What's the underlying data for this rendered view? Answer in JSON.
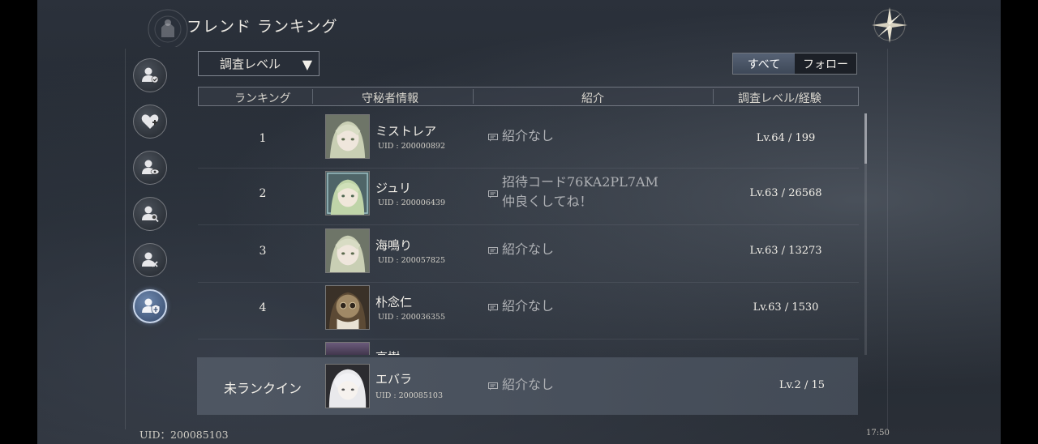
{
  "header": {
    "title": "フレンド ランキング"
  },
  "sidebar": {
    "items": [
      {
        "icon": "user-check-icon",
        "active": false
      },
      {
        "icon": "heart-plus-icon",
        "active": false
      },
      {
        "icon": "user-eye-icon",
        "active": false
      },
      {
        "icon": "user-search-icon",
        "active": false
      },
      {
        "icon": "user-block-icon",
        "active": false
      },
      {
        "icon": "user-shield-icon",
        "active": true
      }
    ]
  },
  "filter": {
    "selected": "調査レベル",
    "arrow": "▼"
  },
  "toggle": {
    "all": "すべて",
    "follow": "フォロー"
  },
  "table": {
    "headers": [
      "ランキング",
      "守秘者情報",
      "紹介",
      "調査レベル/経験"
    ],
    "rows": [
      {
        "rank": "1",
        "name": "ミストレア",
        "uid": "UID : 200000892",
        "intro1": "紹介なし",
        "intro2": "",
        "level": "Lv.64 / 199"
      },
      {
        "rank": "2",
        "name": "ジュリ",
        "uid": "UID : 200006439",
        "intro1": "招待コード76KA2PL7AM",
        "intro2": "仲良くしてね！",
        "level": "Lv.63 / 26568"
      },
      {
        "rank": "3",
        "name": "海鳴り",
        "uid": "UID : 200057825",
        "intro1": "紹介なし",
        "intro2": "",
        "level": "Lv.63 / 13273"
      },
      {
        "rank": "4",
        "name": "朴念仁",
        "uid": "UID : 200036355",
        "intro1": "紹介なし",
        "intro2": "",
        "level": "Lv.63 / 1530"
      }
    ],
    "partial_name": "高樹"
  },
  "me": {
    "rank": "未ランクイン",
    "name": "エバラ",
    "uid": "UID : 200085103",
    "intro": "紹介なし",
    "level": "Lv.2 / 15"
  },
  "footer": {
    "uid": "UID：200085103",
    "time": "17:50"
  },
  "colors": {
    "accent_active": "#3d5274",
    "toggle_on": "#566275"
  }
}
